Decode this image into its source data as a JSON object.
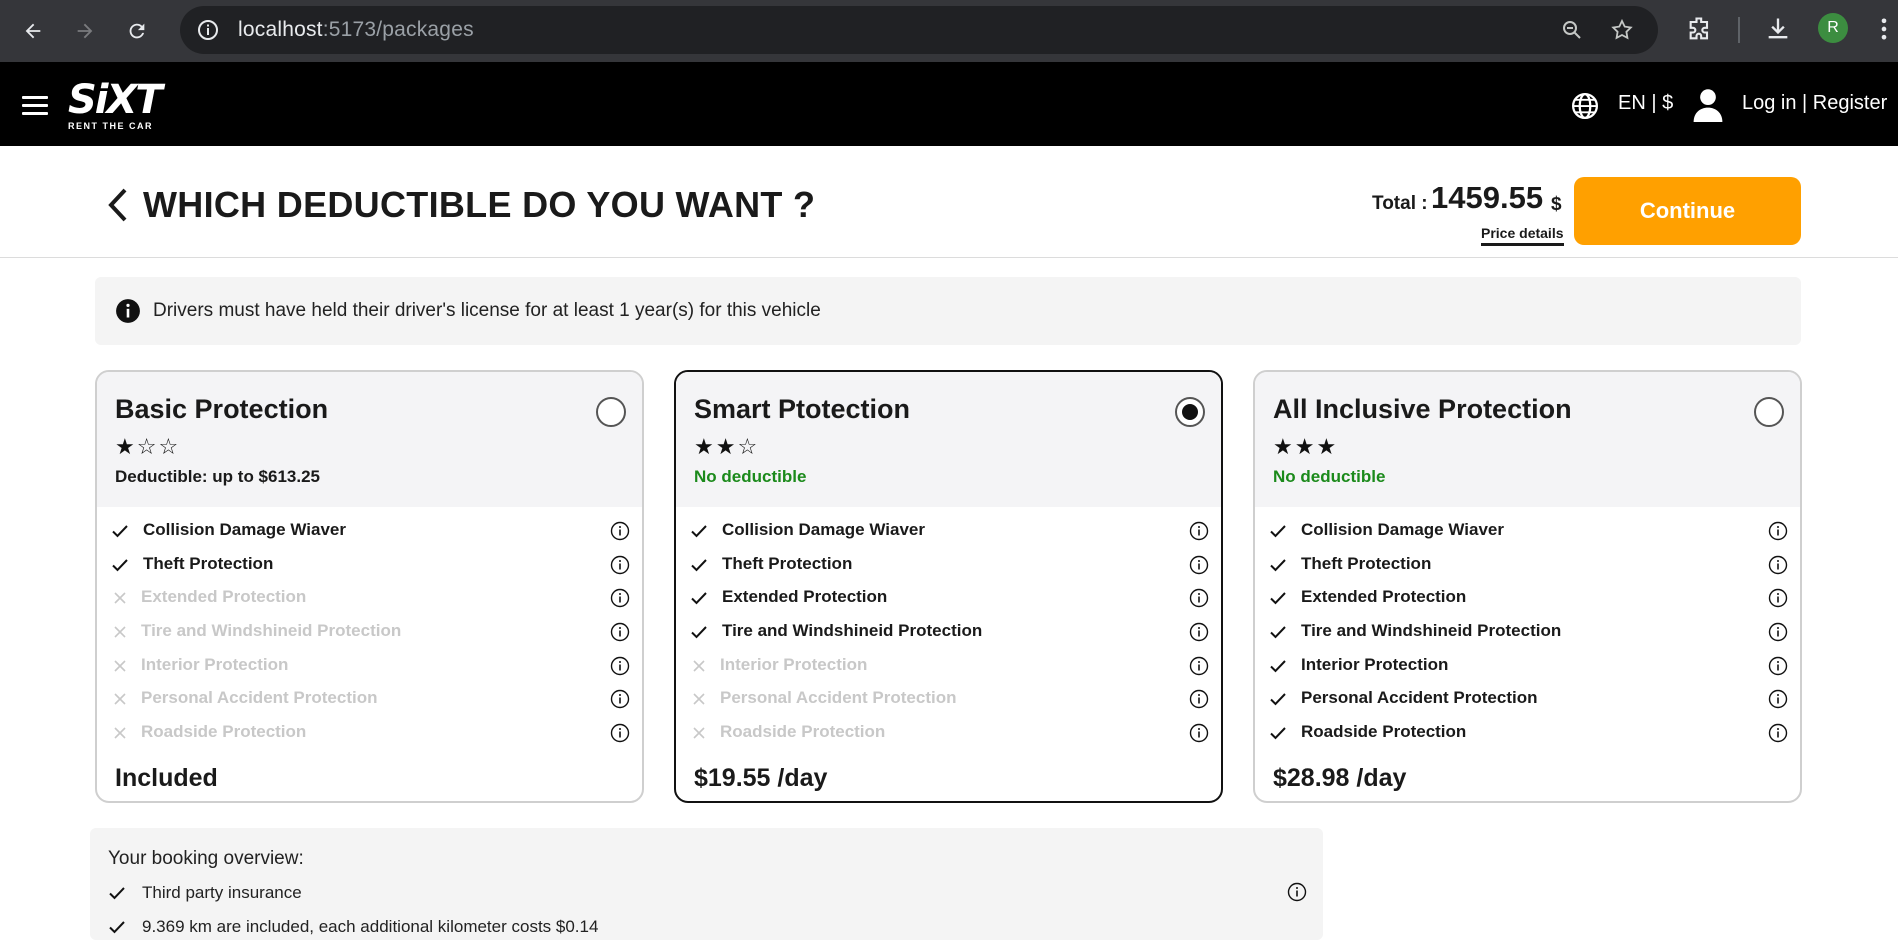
{
  "browser": {
    "url_host": "localhost",
    "url_path": ":5173/packages",
    "profile_initial": "R"
  },
  "header": {
    "logo_text": "SiXT",
    "logo_tagline": "RENT THE CAR",
    "lang_currency": "EN | $",
    "login_label": "Log in | Register"
  },
  "title_bar": {
    "title": "WHICH DEDUCTIBLE DO YOU WANT ?",
    "total_label": "Total :",
    "total_amount": "1459.55",
    "currency": "$",
    "price_details_label": "Price details",
    "continue_label": "Continue"
  },
  "notice": {
    "text": "Drivers must have held their driver's license for at least 1 year(s) for this vehicle"
  },
  "packages": [
    {
      "name": "Basic Protection",
      "stars": "★☆☆",
      "deductible": "Deductible: up to $613.25",
      "selected": false,
      "price": "Included",
      "features": [
        {
          "label": "Collision Damage Wiaver",
          "included": true
        },
        {
          "label": "Theft Protection",
          "included": true
        },
        {
          "label": "Extended Protection",
          "included": false
        },
        {
          "label": "Tire and Windshineid Protection",
          "included": false
        },
        {
          "label": "Interior Protection",
          "included": false
        },
        {
          "label": "Personal Accident Protection",
          "included": false
        },
        {
          "label": "Roadside Protection",
          "included": false
        }
      ]
    },
    {
      "name": "Smart Ptotection",
      "stars": "★★☆",
      "deductible": "No deductible",
      "selected": true,
      "price": "$19.55 /day",
      "features": [
        {
          "label": "Collision Damage Wiaver",
          "included": true
        },
        {
          "label": "Theft Protection",
          "included": true
        },
        {
          "label": "Extended Protection",
          "included": true
        },
        {
          "label": "Tire and Windshineid Protection",
          "included": true
        },
        {
          "label": "Interior Protection",
          "included": false
        },
        {
          "label": "Personal Accident Protection",
          "included": false
        },
        {
          "label": "Roadside Protection",
          "included": false
        }
      ]
    },
    {
      "name": "All Inclusive Protection",
      "stars": "★★★",
      "deductible": "No deductible",
      "selected": false,
      "price": "$28.98 /day",
      "features": [
        {
          "label": "Collision Damage Wiaver",
          "included": true
        },
        {
          "label": "Theft Protection",
          "included": true
        },
        {
          "label": "Extended Protection",
          "included": true
        },
        {
          "label": "Tire and Windshineid Protection",
          "included": true
        },
        {
          "label": "Interior Protection",
          "included": true
        },
        {
          "label": "Personal Accident Protection",
          "included": true
        },
        {
          "label": "Roadside Protection",
          "included": true
        }
      ]
    }
  ],
  "overview": {
    "title": "Your booking overview:",
    "items": [
      "Third party insurance",
      "9.369 km are included, each additional kilometer costs $0.14"
    ]
  },
  "colors": {
    "accent": "#ffa000",
    "green": "#1b8a1b",
    "header_bg": "#000000"
  }
}
